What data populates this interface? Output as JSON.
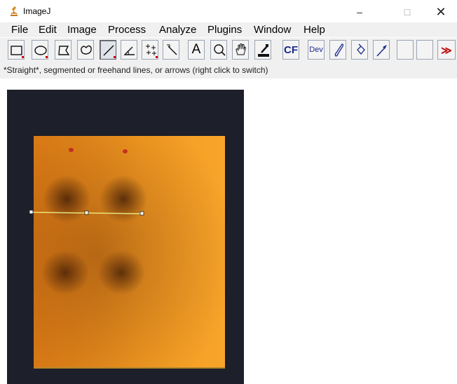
{
  "window": {
    "title": "ImageJ",
    "minimize_label": "–",
    "maximize_label": "□",
    "close_label": "✕"
  },
  "menu": [
    {
      "label": "File"
    },
    {
      "label": "Edit"
    },
    {
      "label": "Image"
    },
    {
      "label": "Process"
    },
    {
      "label": "Analyze"
    },
    {
      "label": "Plugins"
    },
    {
      "label": "Window"
    },
    {
      "label": "Help"
    }
  ],
  "toolbar": {
    "tools": [
      {
        "icon": "rectangle-icon"
      },
      {
        "icon": "oval-icon"
      },
      {
        "icon": "polygon-icon"
      },
      {
        "icon": "freehand-icon"
      },
      {
        "icon": "straight-line-icon",
        "selected": true
      },
      {
        "icon": "angle-icon"
      },
      {
        "icon": "multipoint-icon"
      },
      {
        "icon": "wand-icon"
      },
      {
        "icon": "text-icon",
        "label": "A"
      },
      {
        "icon": "magnifier-icon"
      },
      {
        "icon": "hand-icon"
      },
      {
        "icon": "color-picker-icon"
      },
      {
        "icon": "cf-icon",
        "label": "CF"
      },
      {
        "icon": "dev-icon",
        "label": "Dev"
      },
      {
        "icon": "brush-icon"
      },
      {
        "icon": "flood-fill-icon"
      },
      {
        "icon": "arrow-tool-icon"
      },
      {
        "icon": "more-tools-icon",
        "label": "≫"
      }
    ]
  },
  "status": {
    "text": "*Straight*, segmented or freehand lines, or arrows (right click to switch)"
  },
  "image": {
    "description_colors": {
      "plate": "#f39b22",
      "background": "#1d1f2a",
      "line": "#e8e37a"
    }
  }
}
